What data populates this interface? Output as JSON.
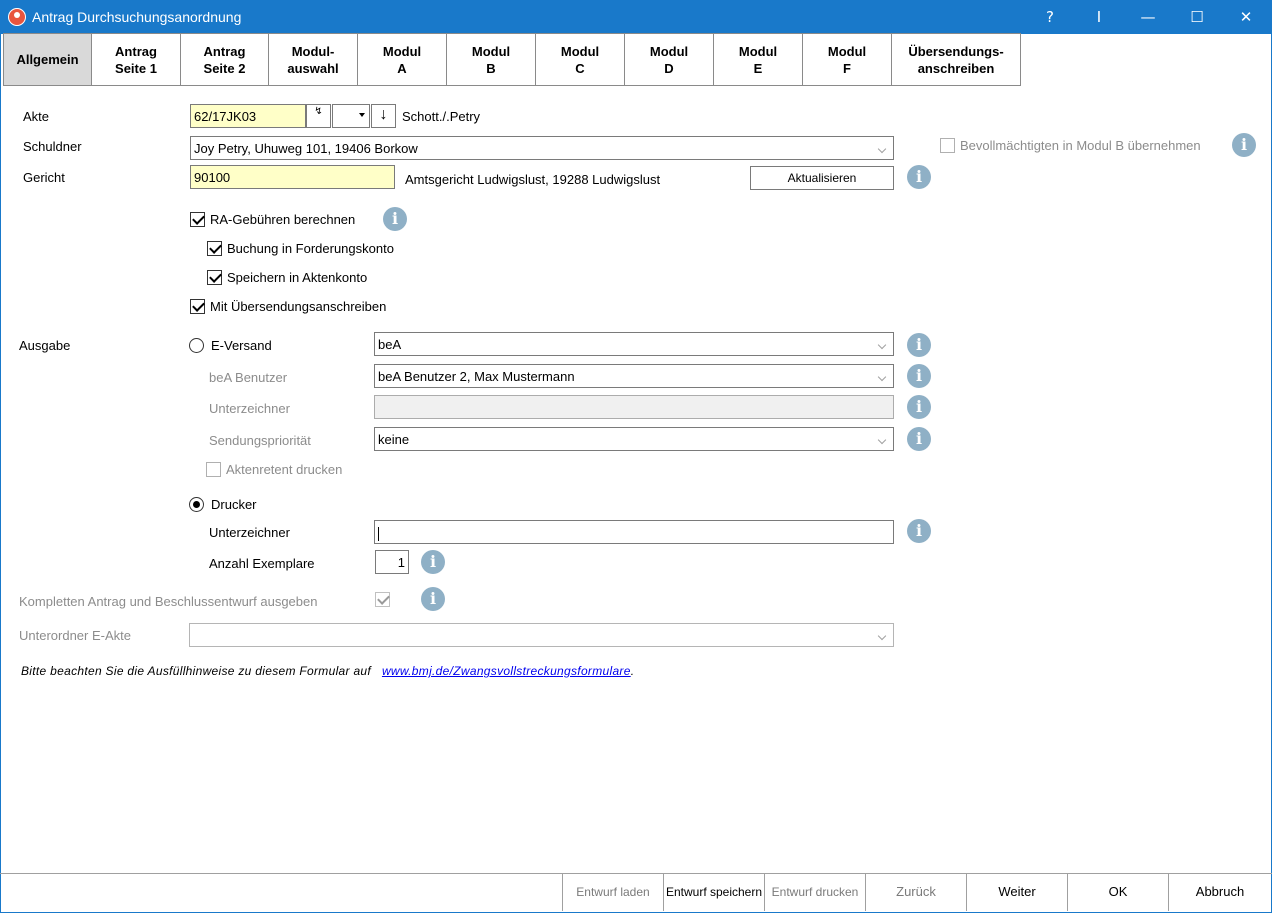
{
  "window": {
    "title": "Antrag Durchsuchungsanordnung",
    "help": "?",
    "cursor": "I",
    "minimize": "—",
    "maximize": "☐",
    "close": "✕"
  },
  "tabs": [
    {
      "label": "Allgemein",
      "active": true
    },
    {
      "label": "Antrag\nSeite 1"
    },
    {
      "label": "Antrag\nSeite 2"
    },
    {
      "label": "Modul-\nauswahl"
    },
    {
      "label": "Modul\nA"
    },
    {
      "label": "Modul\nB"
    },
    {
      "label": "Modul\nC"
    },
    {
      "label": "Modul\nD"
    },
    {
      "label": "Modul\nE"
    },
    {
      "label": "Modul\nF"
    },
    {
      "label": "Übersendungs-\nanschreiben"
    }
  ],
  "form": {
    "akte_label": "Akte",
    "akte_value": "62/17JK03",
    "akte_name": "Schott./.Petry",
    "schuldner_label": "Schuldner",
    "schuldner_value": "Joy Petry, Uhuweg 101, 19406 Borkow",
    "bevollmaechtigten_label": "Bevollmächtigten in Modul B übernehmen",
    "gericht_label": "Gericht",
    "gericht_value": "90100",
    "gericht_name": "Amtsgericht Ludwigslust, 19288 Ludwigslust",
    "aktualisieren_label": "Aktualisieren",
    "ra_gebuehren_label": "RA-Gebühren berechnen",
    "buchung_label": "Buchung in Forderungskonto",
    "speichern_label": "Speichern in Aktenkonto",
    "uebersendung_label": "Mit Übersendungsanschreiben",
    "ausgabe_label": "Ausgabe",
    "eversand_label": "E-Versand",
    "eversand_value": "beA",
    "bea_benutzer_label": "beA Benutzer",
    "bea_benutzer_value": "beA Benutzer 2, Max Mustermann",
    "unterzeichner_label": "Unterzeichner",
    "unterzeichner_value": "",
    "sendungsprioritaet_label": "Sendungspriorität",
    "sendungsprioritaet_value": "keine",
    "aktenretent_label": "Aktenretent drucken",
    "drucker_label": "Drucker",
    "drucker_unterzeichner_label": "Unterzeichner",
    "drucker_unterzeichner_value": "",
    "anzahl_label": "Anzahl Exemplare",
    "anzahl_value": "1",
    "komplett_label": "Kompletten Antrag und Beschlussentwurf ausgeben",
    "unterordner_label": "Unterordner E-Akte",
    "unterordner_value": "",
    "hinweis_text": "Bitte beachten Sie die Ausfüllhinweise zu diesem Formular auf",
    "hinweis_link": "www.bmj.de/Zwangsvollstreckungsformulare",
    "hinweis_end": ".",
    "info_glyph": "i"
  },
  "footer": {
    "entwurf_laden": "Entwurf laden",
    "entwurf_speichern": "Entwurf speichern",
    "entwurf_drucken": "Entwurf drucken",
    "zurueck": "Zurück",
    "weiter": "Weiter",
    "ok": "OK",
    "abbruch": "Abbruch"
  }
}
